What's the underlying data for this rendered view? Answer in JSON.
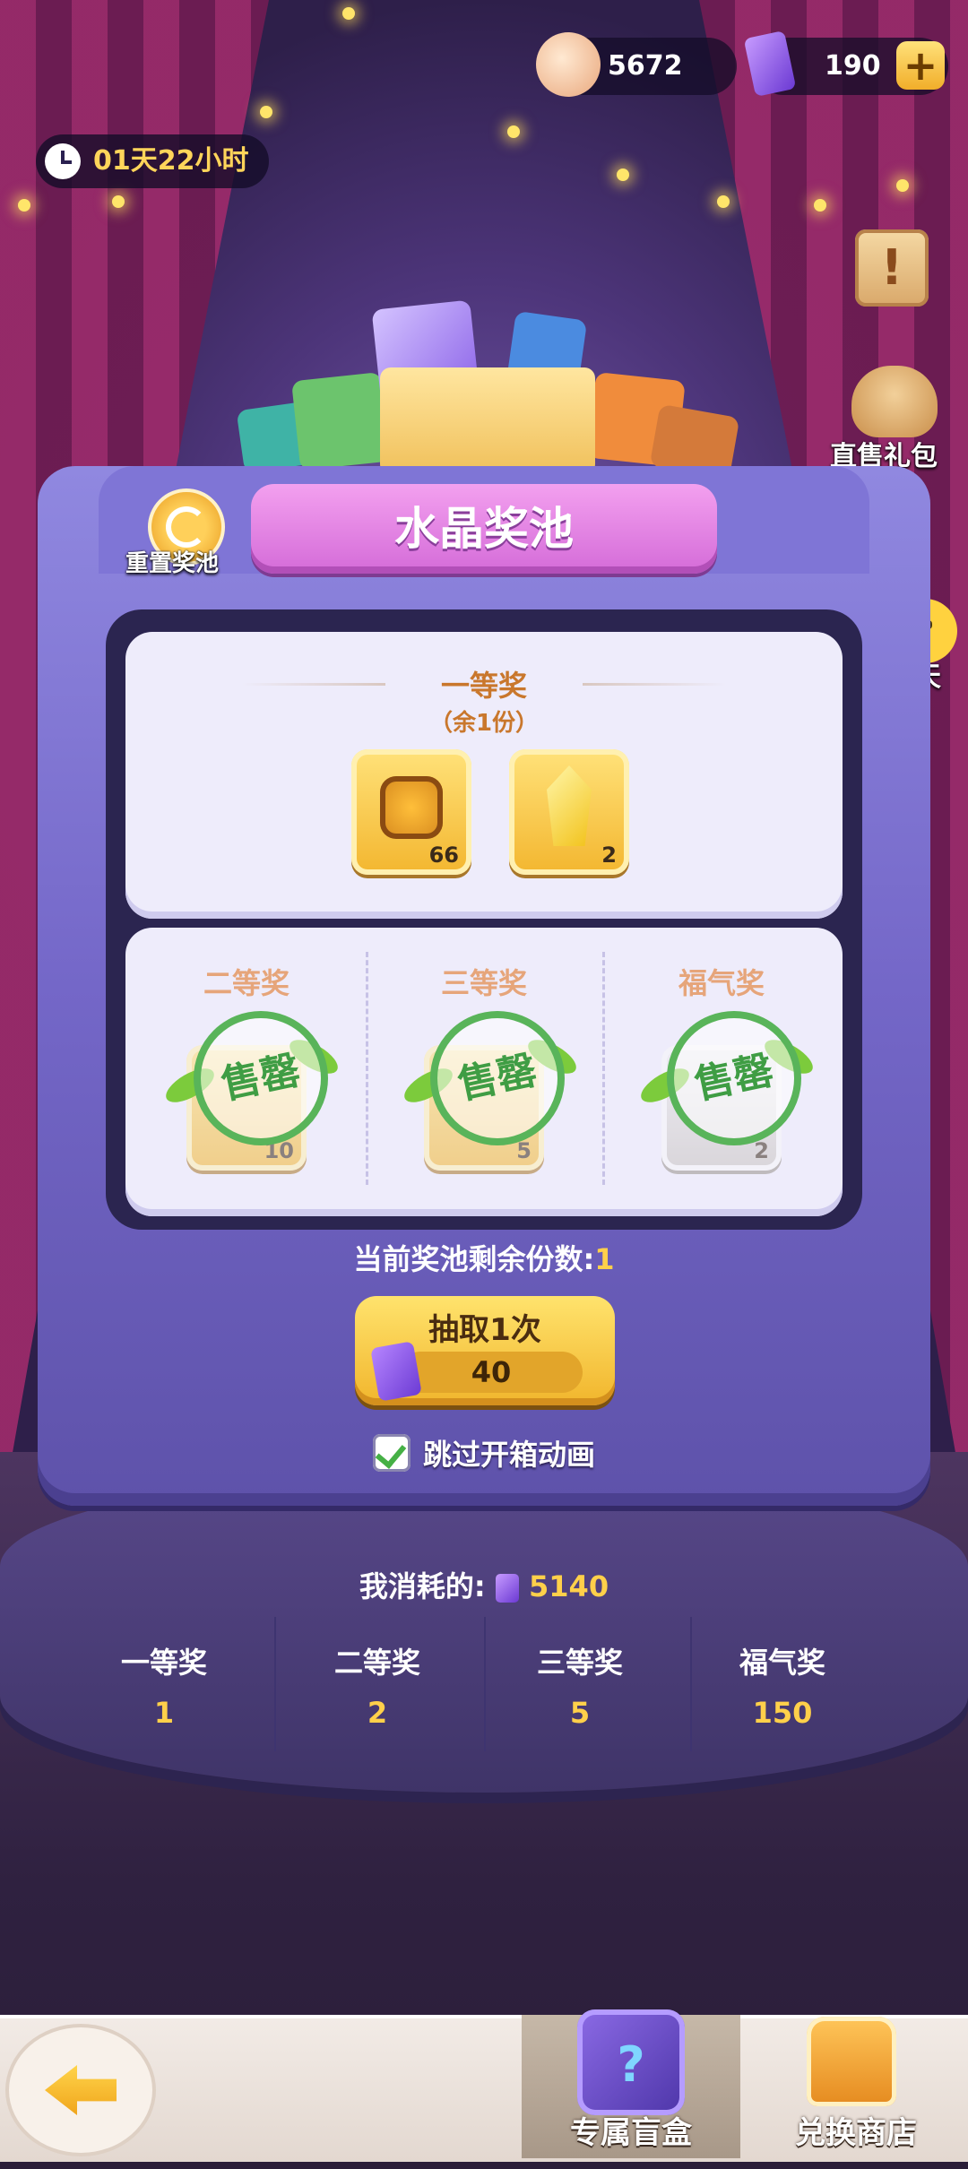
{
  "currencies": {
    "shells": {
      "value": "5672",
      "icon": "shell-icon"
    },
    "tickets": {
      "value": "190",
      "icon": "ticket-icon",
      "add_icon": "plus-icon"
    }
  },
  "timer": {
    "text": "01天22小时",
    "icon": "clock-icon"
  },
  "side_buttons": {
    "notice_icon": "exclamation-scroll-icon",
    "gift_pack_label": "直售礼包",
    "chat_label": "聊天"
  },
  "pool": {
    "title": "水晶奖池",
    "reset_label": "重置奖池",
    "first_prize": {
      "title": "一等奖",
      "remaining": "（余1份）",
      "items": [
        {
          "icon": "coin-token-icon",
          "count": "66"
        },
        {
          "icon": "gold-crystal-icon",
          "count": "2"
        }
      ]
    },
    "other_prizes": [
      {
        "title": "二等奖",
        "count": "10",
        "stamp": "售罄"
      },
      {
        "title": "三等奖",
        "count": "5",
        "stamp": "售罄"
      },
      {
        "title": "福气奖",
        "count": "2",
        "stamp": "售罄"
      }
    ],
    "remaining_label": "当前奖池剩余份数:",
    "remaining_value": "1"
  },
  "draw": {
    "label": "抽取1次",
    "cost": "40",
    "currency_icon": "ticket-icon"
  },
  "skip_animation": {
    "label": "跳过开箱动画",
    "checked": true
  },
  "consumption": {
    "label": "我消耗的:",
    "value": "5140",
    "stats": [
      {
        "name": "一等奖",
        "value": "1"
      },
      {
        "name": "二等奖",
        "value": "2"
      },
      {
        "name": "三等奖",
        "value": "5"
      },
      {
        "name": "福气奖",
        "value": "150"
      }
    ]
  },
  "bottom_nav": {
    "back_icon": "back-arrow-icon",
    "blindbox_label": "专属盲盒",
    "shop_label": "兑换商店"
  },
  "colors": {
    "accent_gold": "#ffd04a",
    "title_pink": "#e07fe2",
    "machine_purple": "#7467c8",
    "sold_out_green": "#59b45a"
  }
}
